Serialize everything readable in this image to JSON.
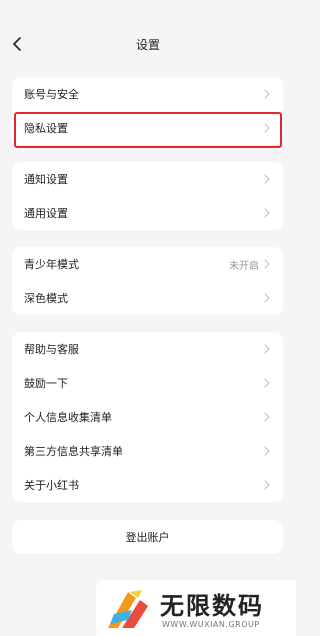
{
  "header": {
    "title": "设置"
  },
  "groups": [
    {
      "items": [
        {
          "label": "账号与安全"
        },
        {
          "label": "隐私设置"
        }
      ]
    },
    {
      "items": [
        {
          "label": "通知设置"
        },
        {
          "label": "通用设置"
        }
      ]
    },
    {
      "items": [
        {
          "label": "青少年模式",
          "value": "未开启"
        },
        {
          "label": "深色模式"
        }
      ]
    },
    {
      "items": [
        {
          "label": "帮助与客服"
        },
        {
          "label": "鼓励一下"
        },
        {
          "label": "个人信息收集清单"
        },
        {
          "label": "第三方信息共享清单"
        },
        {
          "label": "关于小红书"
        }
      ]
    }
  ],
  "logout": {
    "label": "登出账户"
  },
  "watermark": {
    "title": "无限数码",
    "subtitle": "WWW.WUXIAN.GROUP"
  },
  "colors": {
    "highlight": "#e3262c",
    "background": "#f5f5f5",
    "chevron": "#c4c4c4"
  }
}
